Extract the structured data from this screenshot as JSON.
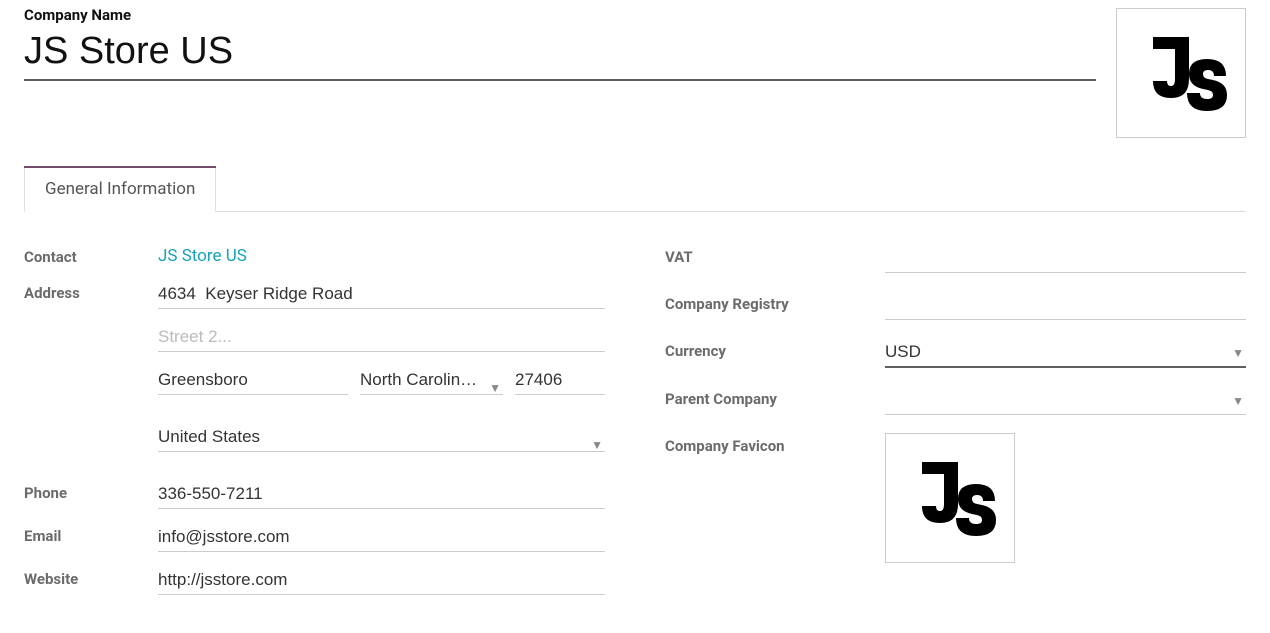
{
  "header": {
    "company_name_label": "Company Name",
    "company_name_value": "JS Store US"
  },
  "tabs": {
    "general_information": "General Information"
  },
  "left": {
    "contact_label": "Contact",
    "contact_value": "JS Store US",
    "address_label": "Address",
    "street1": "4634  Keyser Ridge Road",
    "street2_placeholder": "Street 2...",
    "city": "Greensboro",
    "state": "North Carolina (US)",
    "zip": "27406",
    "country": "United States",
    "phone_label": "Phone",
    "phone_value": "336-550-7211",
    "email_label": "Email",
    "email_value": "info@jsstore.com",
    "website_label": "Website",
    "website_value": "http://jsstore.com"
  },
  "right": {
    "vat_label": "VAT",
    "vat_value": "",
    "registry_label": "Company Registry",
    "registry_value": "",
    "currency_label": "Currency",
    "currency_value": "USD",
    "parent_label": "Parent Company",
    "parent_value": "",
    "favicon_label": "Company Favicon"
  },
  "icons": {
    "logo": "js-logo",
    "favicon": "js-logo"
  }
}
